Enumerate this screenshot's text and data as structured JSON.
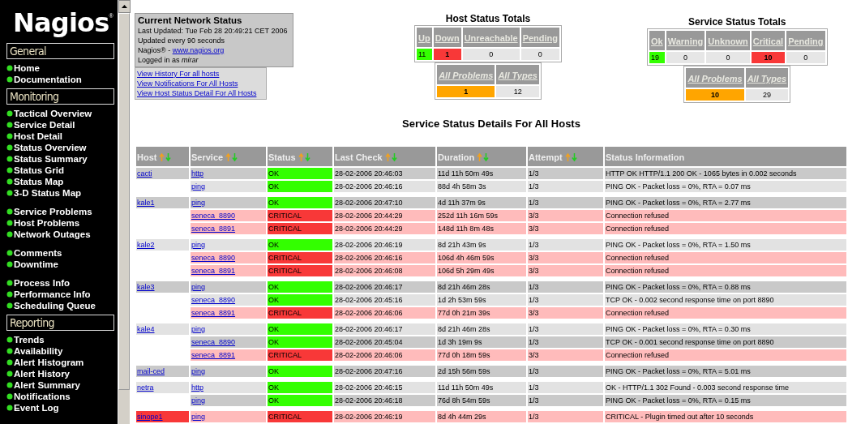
{
  "sidebar": {
    "logo": "Nagios",
    "logo_mark": "®",
    "sections": [
      {
        "title": "General",
        "groups": [
          {
            "items": [
              "Home",
              "Documentation"
            ]
          }
        ]
      },
      {
        "title": "Monitoring",
        "groups": [
          {
            "items": [
              "Tactical Overview",
              "Service Detail",
              "Host Detail",
              "Status Overview",
              "Status Summary",
              "Status Grid",
              "Status Map",
              "3-D Status Map"
            ]
          },
          {
            "items": [
              "Service Problems",
              "Host Problems",
              "Network Outages"
            ]
          },
          {
            "items": [
              "Comments",
              "Downtime"
            ]
          },
          {
            "items": [
              "Process Info",
              "Performance Info",
              "Scheduling Queue"
            ]
          }
        ]
      },
      {
        "title": "Reporting",
        "groups": [
          {
            "items": [
              "Trends",
              "Availability",
              "Alert Histogram",
              "Alert History",
              "Alert Summary",
              "Notifications",
              "Event Log"
            ]
          }
        ]
      }
    ]
  },
  "status_box": {
    "title": "Current Network Status",
    "lines": [
      "Last Updated: Tue Feb 28 20:49:21 CET 2006",
      "Updated every 90 seconds"
    ],
    "site_prefix": "Nagios® - ",
    "site_link": "www.nagios.org",
    "login": "Logged in as *mirar*",
    "links": [
      "View History For all hosts",
      "View Notifications For All Hosts",
      "View Host Status Detail For All Hosts"
    ]
  },
  "host_totals": {
    "title": "Host Status Totals",
    "columns": [
      {
        "label": "Up",
        "value": "11",
        "color": "#33ff00",
        "bold": false
      },
      {
        "label": "Down",
        "value": "1",
        "color": "#f83838",
        "bold": true
      },
      {
        "label": "Unreachable",
        "value": "0",
        "bold": false
      },
      {
        "label": "Pending",
        "value": "0",
        "bold": false
      }
    ],
    "summary": [
      {
        "label": "All Problems",
        "value": "1",
        "color": "#ffa500",
        "bold": true
      },
      {
        "label": "All Types",
        "value": "12",
        "bold": false
      }
    ]
  },
  "service_totals": {
    "title": "Service Status Totals",
    "columns": [
      {
        "label": "Ok",
        "value": "19",
        "color": "#33ff00",
        "bold": false
      },
      {
        "label": "Warning",
        "value": "0",
        "bold": false
      },
      {
        "label": "Unknown",
        "value": "0",
        "bold": false
      },
      {
        "label": "Critical",
        "value": "10",
        "color": "#f83838",
        "bold": true
      },
      {
        "label": "Pending",
        "value": "0",
        "bold": false
      }
    ],
    "summary": [
      {
        "label": "All Problems",
        "value": "10",
        "color": "#ffa500",
        "bold": true
      },
      {
        "label": "All Types",
        "value": "29",
        "bold": false
      }
    ]
  },
  "table": {
    "title": "Service Status Details For All Hosts",
    "columns": [
      {
        "label": "Host",
        "sortable": true
      },
      {
        "label": "Service",
        "sortable": true
      },
      {
        "label": "Status",
        "sortable": true
      },
      {
        "label": "Last Check",
        "sortable": true
      },
      {
        "label": "Duration",
        "sortable": true
      },
      {
        "label": "Attempt",
        "sortable": true
      },
      {
        "label": "Status Information",
        "sortable": false
      }
    ],
    "hosts": [
      {
        "name": "cacti",
        "down": false,
        "services": [
          {
            "name": "http",
            "kind": "ok",
            "status": "OK",
            "last_check": "28-02-2006 20:46:03",
            "duration": "11d 11h 50m 49s",
            "attempt": "1/3",
            "info": "HTTP OK HTTP/1.1 200 OK - 1065 bytes in 0.002 seconds"
          },
          {
            "name": "ping",
            "kind": "ok",
            "status": "OK",
            "last_check": "28-02-2006 20:46:16",
            "duration": "88d 4h 58m 3s",
            "attempt": "1/3",
            "info": "PING OK - Packet loss = 0%, RTA = 0.07 ms"
          }
        ]
      },
      {
        "name": "kale1",
        "down": false,
        "services": [
          {
            "name": "ping",
            "kind": "ok",
            "status": "OK",
            "last_check": "28-02-2006 20:47:10",
            "duration": "4d 11h 37m 9s",
            "attempt": "1/3",
            "info": "PING OK - Packet loss = 0%, RTA = 2.77 ms"
          },
          {
            "name": "seneca_8890",
            "kind": "critical",
            "status": "CRITICAL",
            "last_check": "28-02-2006 20:44:29",
            "duration": "252d 11h 16m 59s",
            "attempt": "3/3",
            "info": "Connection refused"
          },
          {
            "name": "seneca_8891",
            "kind": "critical",
            "status": "CRITICAL",
            "last_check": "28-02-2006 20:44:29",
            "duration": "148d 11h 8m 48s",
            "attempt": "3/3",
            "info": "Connection refused"
          }
        ]
      },
      {
        "name": "kale2",
        "down": false,
        "services": [
          {
            "name": "ping",
            "kind": "ok",
            "status": "OK",
            "last_check": "28-02-2006 20:46:19",
            "duration": "8d 21h 43m 9s",
            "attempt": "1/3",
            "info": "PING OK - Packet loss = 0%, RTA = 1.50 ms"
          },
          {
            "name": "seneca_8890",
            "kind": "critical",
            "status": "CRITICAL",
            "last_check": "28-02-2006 20:46:16",
            "duration": "106d 4h 46m 59s",
            "attempt": "3/3",
            "info": "Connection refused"
          },
          {
            "name": "seneca_8891",
            "kind": "critical",
            "status": "CRITICAL",
            "last_check": "28-02-2006 20:46:08",
            "duration": "106d 5h 29m 49s",
            "attempt": "3/3",
            "info": "Connection refused"
          }
        ]
      },
      {
        "name": "kale3",
        "down": false,
        "services": [
          {
            "name": "ping",
            "kind": "ok",
            "status": "OK",
            "last_check": "28-02-2006 20:46:17",
            "duration": "8d 21h 46m 28s",
            "attempt": "1/3",
            "info": "PING OK - Packet loss = 0%, RTA = 0.88 ms"
          },
          {
            "name": "seneca_8890",
            "kind": "ok",
            "status": "OK",
            "last_check": "28-02-2006 20:45:16",
            "duration": "1d 2h 53m 59s",
            "attempt": "1/3",
            "info": "TCP OK - 0.002 second response time on port 8890"
          },
          {
            "name": "seneca_8891",
            "kind": "critical",
            "status": "CRITICAL",
            "last_check": "28-02-2006 20:46:06",
            "duration": "77d 0h 21m 39s",
            "attempt": "3/3",
            "info": "Connection refused"
          }
        ]
      },
      {
        "name": "kale4",
        "down": false,
        "services": [
          {
            "name": "ping",
            "kind": "ok",
            "status": "OK",
            "last_check": "28-02-2006 20:46:17",
            "duration": "8d 21h 46m 28s",
            "attempt": "1/3",
            "info": "PING OK - Packet loss = 0%, RTA = 0.30 ms"
          },
          {
            "name": "seneca_8890",
            "kind": "ok",
            "status": "OK",
            "last_check": "28-02-2006 20:45:04",
            "duration": "1d 3h 19m 9s",
            "attempt": "1/3",
            "info": "TCP OK - 0.001 second response time on port 8890"
          },
          {
            "name": "seneca_8891",
            "kind": "critical",
            "status": "CRITICAL",
            "last_check": "28-02-2006 20:46:06",
            "duration": "77d 0h 18m 59s",
            "attempt": "3/3",
            "info": "Connection refused"
          }
        ]
      },
      {
        "name": "mail-ced",
        "down": false,
        "services": [
          {
            "name": "ping",
            "kind": "ok",
            "status": "OK",
            "last_check": "28-02-2006 20:47:16",
            "duration": "2d 15h 56m 59s",
            "attempt": "1/3",
            "info": "PING OK - Packet loss = 0%, RTA = 5.01 ms"
          }
        ]
      },
      {
        "name": "netra",
        "down": false,
        "services": [
          {
            "name": "http",
            "kind": "ok",
            "status": "OK",
            "last_check": "28-02-2006 20:46:15",
            "duration": "11d 11h 50m 49s",
            "attempt": "1/3",
            "info": "OK - HTTP/1.1 302 Found - 0.003 second response time"
          },
          {
            "name": "ping",
            "kind": "ok",
            "status": "OK",
            "last_check": "28-02-2006 20:46:18",
            "duration": "76d 8h 54m 59s",
            "attempt": "1/3",
            "info": "PING OK - Packet loss = 0%, RTA = 0.15 ms"
          }
        ]
      },
      {
        "name": "sinope1",
        "down": true,
        "services": [
          {
            "name": "ping",
            "kind": "critical",
            "status": "CRITICAL",
            "last_check": "28-02-2006 20:46:19",
            "duration": "8d 4h 44m 29s",
            "attempt": "1/3",
            "info": "CRITICAL - Plugin timed out after 10 seconds"
          }
        ]
      }
    ]
  }
}
